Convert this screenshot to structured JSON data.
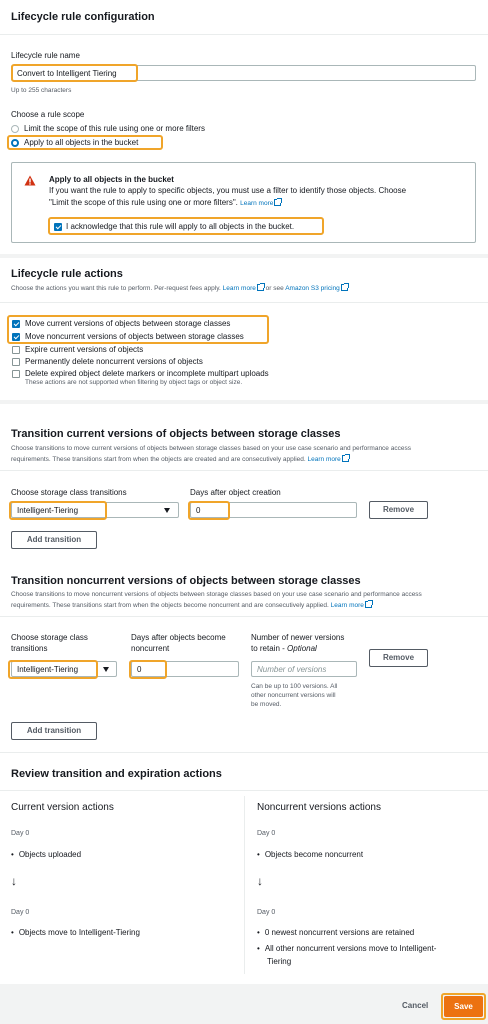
{
  "config": {
    "title": "Lifecycle rule configuration",
    "name_label": "Lifecycle rule name",
    "name_value": "Convert to Intelligent Tiering",
    "name_hint": "Up to 255 characters",
    "scope_label": "Choose a rule scope",
    "scope_option_filter": "Limit the scope of this rule using one or more filters",
    "scope_option_all": "Apply to all objects in the bucket",
    "scope_selected": "Apply to all objects in the bucket",
    "warning": {
      "title": "Apply to all objects in the bucket",
      "body_1": "If you want the rule to apply to specific objects, you must use a filter to identify those objects. Choose",
      "body_2": "\"Limit the scope of this rule using one or more filters\".",
      "learn_more": "Learn more",
      "ack_label": "I acknowledge that this rule will apply to all objects in the bucket.",
      "ack_checked": true
    }
  },
  "actions": {
    "title": "Lifecycle rule actions",
    "desc_pre": "Choose the actions you want this rule to perform. Per-request fees apply.",
    "learn_more": "Learn more",
    "or_see": "or see",
    "pricing_link": "Amazon S3 pricing",
    "items": [
      {
        "label": "Move current versions of objects between storage classes",
        "checked": true
      },
      {
        "label": "Move noncurrent versions of objects between storage classes",
        "checked": true
      },
      {
        "label": "Expire current versions of objects",
        "checked": false
      },
      {
        "label": "Permanently delete noncurrent versions of objects",
        "checked": false
      },
      {
        "label": "Delete expired object delete markers or incomplete multipart uploads",
        "checked": false
      }
    ],
    "items_hint": "These actions are not supported when filtering by object tags or object size."
  },
  "current_transitions": {
    "title": "Transition current versions of objects between storage classes",
    "desc_1": "Choose transitions to move current versions of objects between storage classes based on your use case scenario and performance access",
    "desc_2": "requirements. These transitions start from when the objects are created and are consecutively applied.",
    "learn_more": "Learn more",
    "storage_label": "Choose storage class transitions",
    "days_label": "Days after object creation",
    "storage_value": "Intelligent-Tiering",
    "days_value": "0",
    "remove_label": "Remove",
    "add_label": "Add transition"
  },
  "noncurrent_transitions": {
    "title": "Transition noncurrent versions of objects between storage classes",
    "desc_1": "Choose transitions to move noncurrent versions of objects between storage classes based on your use case scenario and performance access",
    "desc_2": "requirements. These transitions start from when the objects become noncurrent and are consecutively applied.",
    "learn_more": "Learn more",
    "storage_label_1": "Choose storage class",
    "storage_label_2": "transitions",
    "days_label_1": "Days after objects become",
    "days_label_2": "noncurrent",
    "versions_label_1": "Number of newer versions",
    "versions_label_2": "to retain - ",
    "versions_optional": "Optional",
    "storage_value": "Intelligent-Tiering",
    "days_value": "0",
    "versions_placeholder": "Number of versions",
    "versions_hint_1": "Can be up to 100 versions. All",
    "versions_hint_2": "other noncurrent versions will",
    "versions_hint_3": "be moved.",
    "remove_label": "Remove",
    "add_label": "Add transition"
  },
  "review": {
    "title": "Review transition and expiration actions",
    "current": {
      "heading": "Current version actions",
      "day_a": "Day 0",
      "item_a": "Objects uploaded",
      "day_b": "Day 0",
      "item_b": "Objects move to Intelligent-Tiering"
    },
    "noncurrent": {
      "heading": "Noncurrent versions actions",
      "day_a": "Day 0",
      "item_a": "Objects become noncurrent",
      "day_b": "Day 0",
      "item_b": "0 newest noncurrent versions are retained",
      "item_c_1": "All other noncurrent versions move to Intelligent-",
      "item_c_2": "Tiering"
    }
  },
  "footer": {
    "cancel_label": "Cancel",
    "save_label": "Save"
  },
  "colors": {
    "accent": "#0073bb",
    "highlight": "#f0a52a",
    "primary_button": "#ec7211"
  }
}
